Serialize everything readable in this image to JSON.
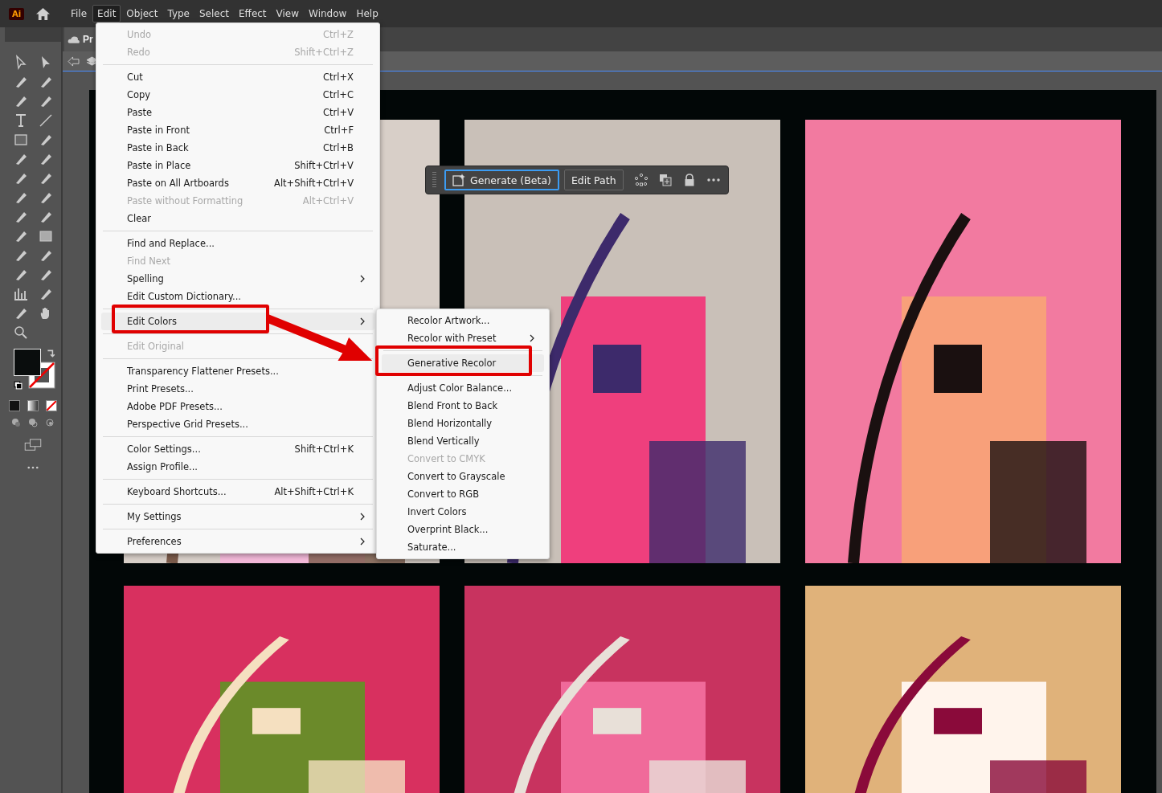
{
  "menubar": [
    {
      "label": "File",
      "selected": false
    },
    {
      "label": "Edit",
      "selected": true
    },
    {
      "label": "Object",
      "selected": false
    },
    {
      "label": "Type",
      "selected": false
    },
    {
      "label": "Select",
      "selected": false
    },
    {
      "label": "Effect",
      "selected": false
    },
    {
      "label": "View",
      "selected": false
    },
    {
      "label": "Window",
      "selected": false
    },
    {
      "label": "Help",
      "selected": false
    }
  ],
  "app_logo": "Ai",
  "document_tab": {
    "title": "Pr"
  },
  "context_toolbar": {
    "buttons": [
      {
        "label": "Generate (Beta)",
        "selected": true
      },
      {
        "label": "Edit Path",
        "selected": false
      }
    ]
  },
  "edit_menu": [
    {
      "kind": "item",
      "label": "Undo",
      "shortcut": "Ctrl+Z",
      "disabled": true,
      "selected": false,
      "submenu": false
    },
    {
      "kind": "item",
      "label": "Redo",
      "shortcut": "Shift+Ctrl+Z",
      "disabled": true,
      "selected": false,
      "submenu": false
    },
    {
      "kind": "separator"
    },
    {
      "kind": "item",
      "label": "Cut",
      "shortcut": "Ctrl+X",
      "disabled": false,
      "selected": false,
      "submenu": false
    },
    {
      "kind": "item",
      "label": "Copy",
      "shortcut": "Ctrl+C",
      "disabled": false,
      "selected": false,
      "submenu": false
    },
    {
      "kind": "item",
      "label": "Paste",
      "shortcut": "Ctrl+V",
      "disabled": false,
      "selected": false,
      "submenu": false
    },
    {
      "kind": "item",
      "label": "Paste in Front",
      "shortcut": "Ctrl+F",
      "disabled": false,
      "selected": false,
      "submenu": false
    },
    {
      "kind": "item",
      "label": "Paste in Back",
      "shortcut": "Ctrl+B",
      "disabled": false,
      "selected": false,
      "submenu": false
    },
    {
      "kind": "item",
      "label": "Paste in Place",
      "shortcut": "Shift+Ctrl+V",
      "disabled": false,
      "selected": false,
      "submenu": false
    },
    {
      "kind": "item",
      "label": "Paste on All Artboards",
      "shortcut": "Alt+Shift+Ctrl+V",
      "disabled": false,
      "selected": false,
      "submenu": false
    },
    {
      "kind": "item",
      "label": "Paste without Formatting",
      "shortcut": "Alt+Ctrl+V",
      "disabled": true,
      "selected": false,
      "submenu": false
    },
    {
      "kind": "item",
      "label": "Clear",
      "disabled": false,
      "selected": false,
      "submenu": false
    },
    {
      "kind": "separator"
    },
    {
      "kind": "item",
      "label": "Find and Replace...",
      "disabled": false,
      "selected": false,
      "submenu": false
    },
    {
      "kind": "item",
      "label": "Find Next",
      "disabled": true,
      "selected": false,
      "submenu": false
    },
    {
      "kind": "item",
      "label": "Spelling",
      "disabled": false,
      "selected": false,
      "submenu": true
    },
    {
      "kind": "item",
      "label": "Edit Custom Dictionary...",
      "disabled": false,
      "selected": false,
      "submenu": false
    },
    {
      "kind": "separator"
    },
    {
      "kind": "item",
      "label": "Edit Colors",
      "disabled": false,
      "selected": true,
      "submenu": true
    },
    {
      "kind": "separator"
    },
    {
      "kind": "item",
      "label": "Edit Original",
      "disabled": true,
      "selected": false,
      "submenu": false
    },
    {
      "kind": "separator"
    },
    {
      "kind": "item",
      "label": "Transparency Flattener Presets...",
      "disabled": false,
      "selected": false,
      "submenu": false
    },
    {
      "kind": "item",
      "label": "Print Presets...",
      "disabled": false,
      "selected": false,
      "submenu": false
    },
    {
      "kind": "item",
      "label": "Adobe PDF Presets...",
      "disabled": false,
      "selected": false,
      "submenu": false
    },
    {
      "kind": "item",
      "label": "Perspective Grid Presets...",
      "disabled": false,
      "selected": false,
      "submenu": false
    },
    {
      "kind": "separator"
    },
    {
      "kind": "item",
      "label": "Color Settings...",
      "shortcut": "Shift+Ctrl+K",
      "disabled": false,
      "selected": false,
      "submenu": false
    },
    {
      "kind": "item",
      "label": "Assign Profile...",
      "disabled": false,
      "selected": false,
      "submenu": false
    },
    {
      "kind": "separator"
    },
    {
      "kind": "item",
      "label": "Keyboard Shortcuts...",
      "shortcut": "Alt+Shift+Ctrl+K",
      "disabled": false,
      "selected": false,
      "submenu": false
    },
    {
      "kind": "separator"
    },
    {
      "kind": "item",
      "label": "My Settings",
      "disabled": false,
      "selected": false,
      "submenu": true
    },
    {
      "kind": "separator"
    },
    {
      "kind": "item",
      "label": "Preferences",
      "disabled": false,
      "selected": false,
      "submenu": true
    }
  ],
  "edit_colors_submenu": [
    {
      "kind": "item",
      "label": "Recolor Artwork...",
      "disabled": false,
      "selected": false,
      "submenu": false
    },
    {
      "kind": "item",
      "label": "Recolor with Preset",
      "disabled": false,
      "selected": false,
      "submenu": true
    },
    {
      "kind": "separator"
    },
    {
      "kind": "item",
      "label": "Generative Recolor",
      "disabled": false,
      "selected": true,
      "submenu": false
    },
    {
      "kind": "separator"
    },
    {
      "kind": "item",
      "label": "Adjust Color Balance...",
      "disabled": false,
      "selected": false,
      "submenu": false
    },
    {
      "kind": "item",
      "label": "Blend Front to Back",
      "disabled": false,
      "selected": false,
      "submenu": false
    },
    {
      "kind": "item",
      "label": "Blend Horizontally",
      "disabled": false,
      "selected": false,
      "submenu": false
    },
    {
      "kind": "item",
      "label": "Blend Vertically",
      "disabled": false,
      "selected": false,
      "submenu": false
    },
    {
      "kind": "item",
      "label": "Convert to CMYK",
      "disabled": true,
      "selected": false,
      "submenu": false
    },
    {
      "kind": "item",
      "label": "Convert to Grayscale",
      "disabled": false,
      "selected": false,
      "submenu": false
    },
    {
      "kind": "item",
      "label": "Convert to RGB",
      "disabled": false,
      "selected": false,
      "submenu": false
    },
    {
      "kind": "item",
      "label": "Invert Colors",
      "disabled": false,
      "selected": false,
      "submenu": false
    },
    {
      "kind": "item",
      "label": "Overprint Black...",
      "disabled": false,
      "selected": false,
      "submenu": false
    },
    {
      "kind": "item",
      "label": "Saturate...",
      "disabled": false,
      "selected": false,
      "submenu": false
    }
  ]
}
